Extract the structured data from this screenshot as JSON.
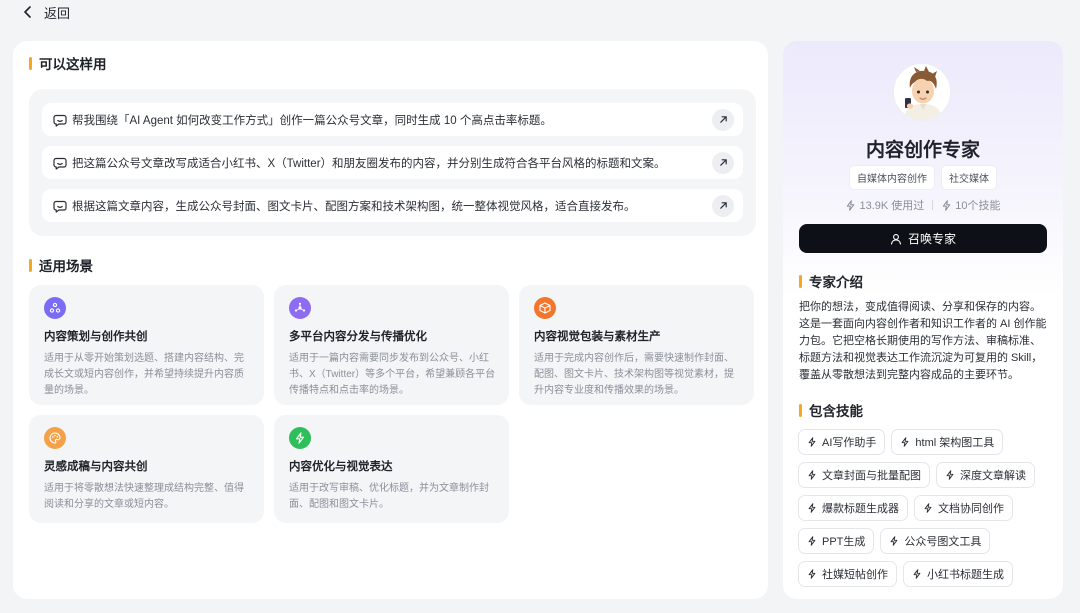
{
  "topbar": {
    "back_label": "返回"
  },
  "usage": {
    "title": "可以这样用",
    "prompts": [
      "帮我围绕「AI Agent 如何改变工作方式」创作一篇公众号文章，同时生成 10 个高点击率标题。",
      "把这篇公众号文章改写成适合小红书、X（Twitter）和朋友圈发布的内容，并分别生成符合各平台风格的标题和文案。",
      "根据这篇文章内容，生成公众号封面、图文卡片、配图方案和技术架构图，统一整体视觉风格，适合直接发布。"
    ]
  },
  "scenes": {
    "title": "适用场景",
    "cards": [
      {
        "title": "内容策划与创作共创",
        "desc": "适用于从零开始策划选题、搭建内容结构、完成长文或短内容创作，并希望持续提升内容质量的场景。",
        "icon": "plan-icon",
        "color": "#7b6cf6"
      },
      {
        "title": "多平台内容分发与传播优化",
        "desc": "适用于一篇内容需要同步发布到公众号、小红书、X（Twitter）等多个平台，希望兼顾各平台传播特点和点击率的场景。",
        "icon": "share-icon",
        "color": "#8e6cf1"
      },
      {
        "title": "内容视觉包装与素材生产",
        "desc": "适用于完成内容创作后，需要快速制作封面、配图、图文卡片、技术架构图等视觉素材，提升内容专业度和传播效果的场景。",
        "icon": "box-icon",
        "color": "#f2762e"
      },
      {
        "title": "灵感成稿与内容共创",
        "desc": "适用于将零散想法快速整理成结构完整、值得阅读和分享的文章或短内容。",
        "icon": "palette-icon",
        "color": "#f5a14a"
      },
      {
        "title": "内容优化与视觉表达",
        "desc": "适用于改写审稿、优化标题，并为文章制作封面、配图和图文卡片。",
        "icon": "bolt-icon",
        "color": "#2fbf5a"
      }
    ]
  },
  "expert": {
    "name": "内容创作专家",
    "tags": [
      "自媒体内容创作",
      "社交媒体"
    ],
    "uses": "13.9K 使用过",
    "skills_count": "10个技能",
    "summon_label": "召唤专家",
    "intro_title": "专家介绍",
    "intro": "把你的想法，变成值得阅读、分享和保存的内容。这是一套面向内容创作者和知识工作者的 AI 创作能力包。它把空格长期使用的写作方法、审稿标准、标题方法和视觉表达工作流沉淀为可复用的 Skill，覆盖从零散想法到完整内容成品的主要环节。",
    "skills_title": "包含技能",
    "skills": [
      "AI写作助手",
      "html 架构图工具",
      "文章封面与批量配图",
      "深度文章解读",
      "爆款标题生成器",
      "文档协同创作",
      "PPT生成",
      "公众号图文工具",
      "社媒短帖创作",
      "小红书标题生成"
    ]
  }
}
